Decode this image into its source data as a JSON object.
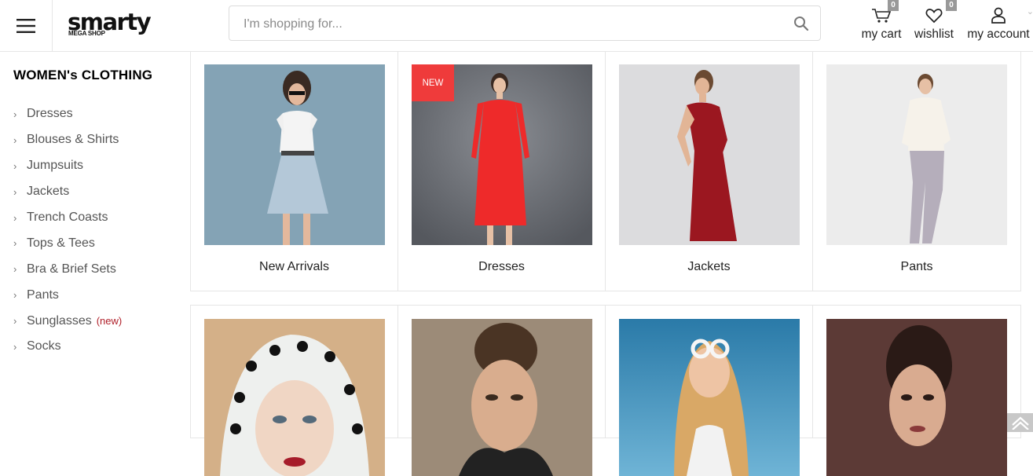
{
  "header": {
    "logo_name": "smarty",
    "logo_sub": "MEGA SHOP",
    "search_placeholder": "I'm shopping for...",
    "cart": {
      "label": "my cart",
      "count": "0"
    },
    "wishlist": {
      "label": "wishlist",
      "count": "0"
    },
    "account": {
      "label": "my account"
    },
    "icons": [
      "menu-icon",
      "search-icon",
      "cart-icon",
      "heart-icon",
      "user-icon",
      "chevron-down-icon"
    ]
  },
  "sidebar": {
    "title": "WOMEN's CLOTHING",
    "items": [
      {
        "label": "Dresses"
      },
      {
        "label": "Blouses & Shirts"
      },
      {
        "label": "Jumpsuits"
      },
      {
        "label": "Jackets"
      },
      {
        "label": "Trench Coasts"
      },
      {
        "label": "Tops & Tees"
      },
      {
        "label": "Bra & Brief Sets"
      },
      {
        "label": "Pants"
      },
      {
        "label": "Sunglasses",
        "tag": "(new)"
      },
      {
        "label": "Socks"
      }
    ]
  },
  "categories": [
    {
      "label": "New Arrivals"
    },
    {
      "label": "Dresses",
      "badge": "NEW"
    },
    {
      "label": "Jackets"
    },
    {
      "label": "Pants"
    }
  ],
  "colors": {
    "badge_new": "#ef3b3b",
    "tag_new": "#b0202a",
    "border": "#e6e6e6",
    "count_badge": "#999999"
  }
}
